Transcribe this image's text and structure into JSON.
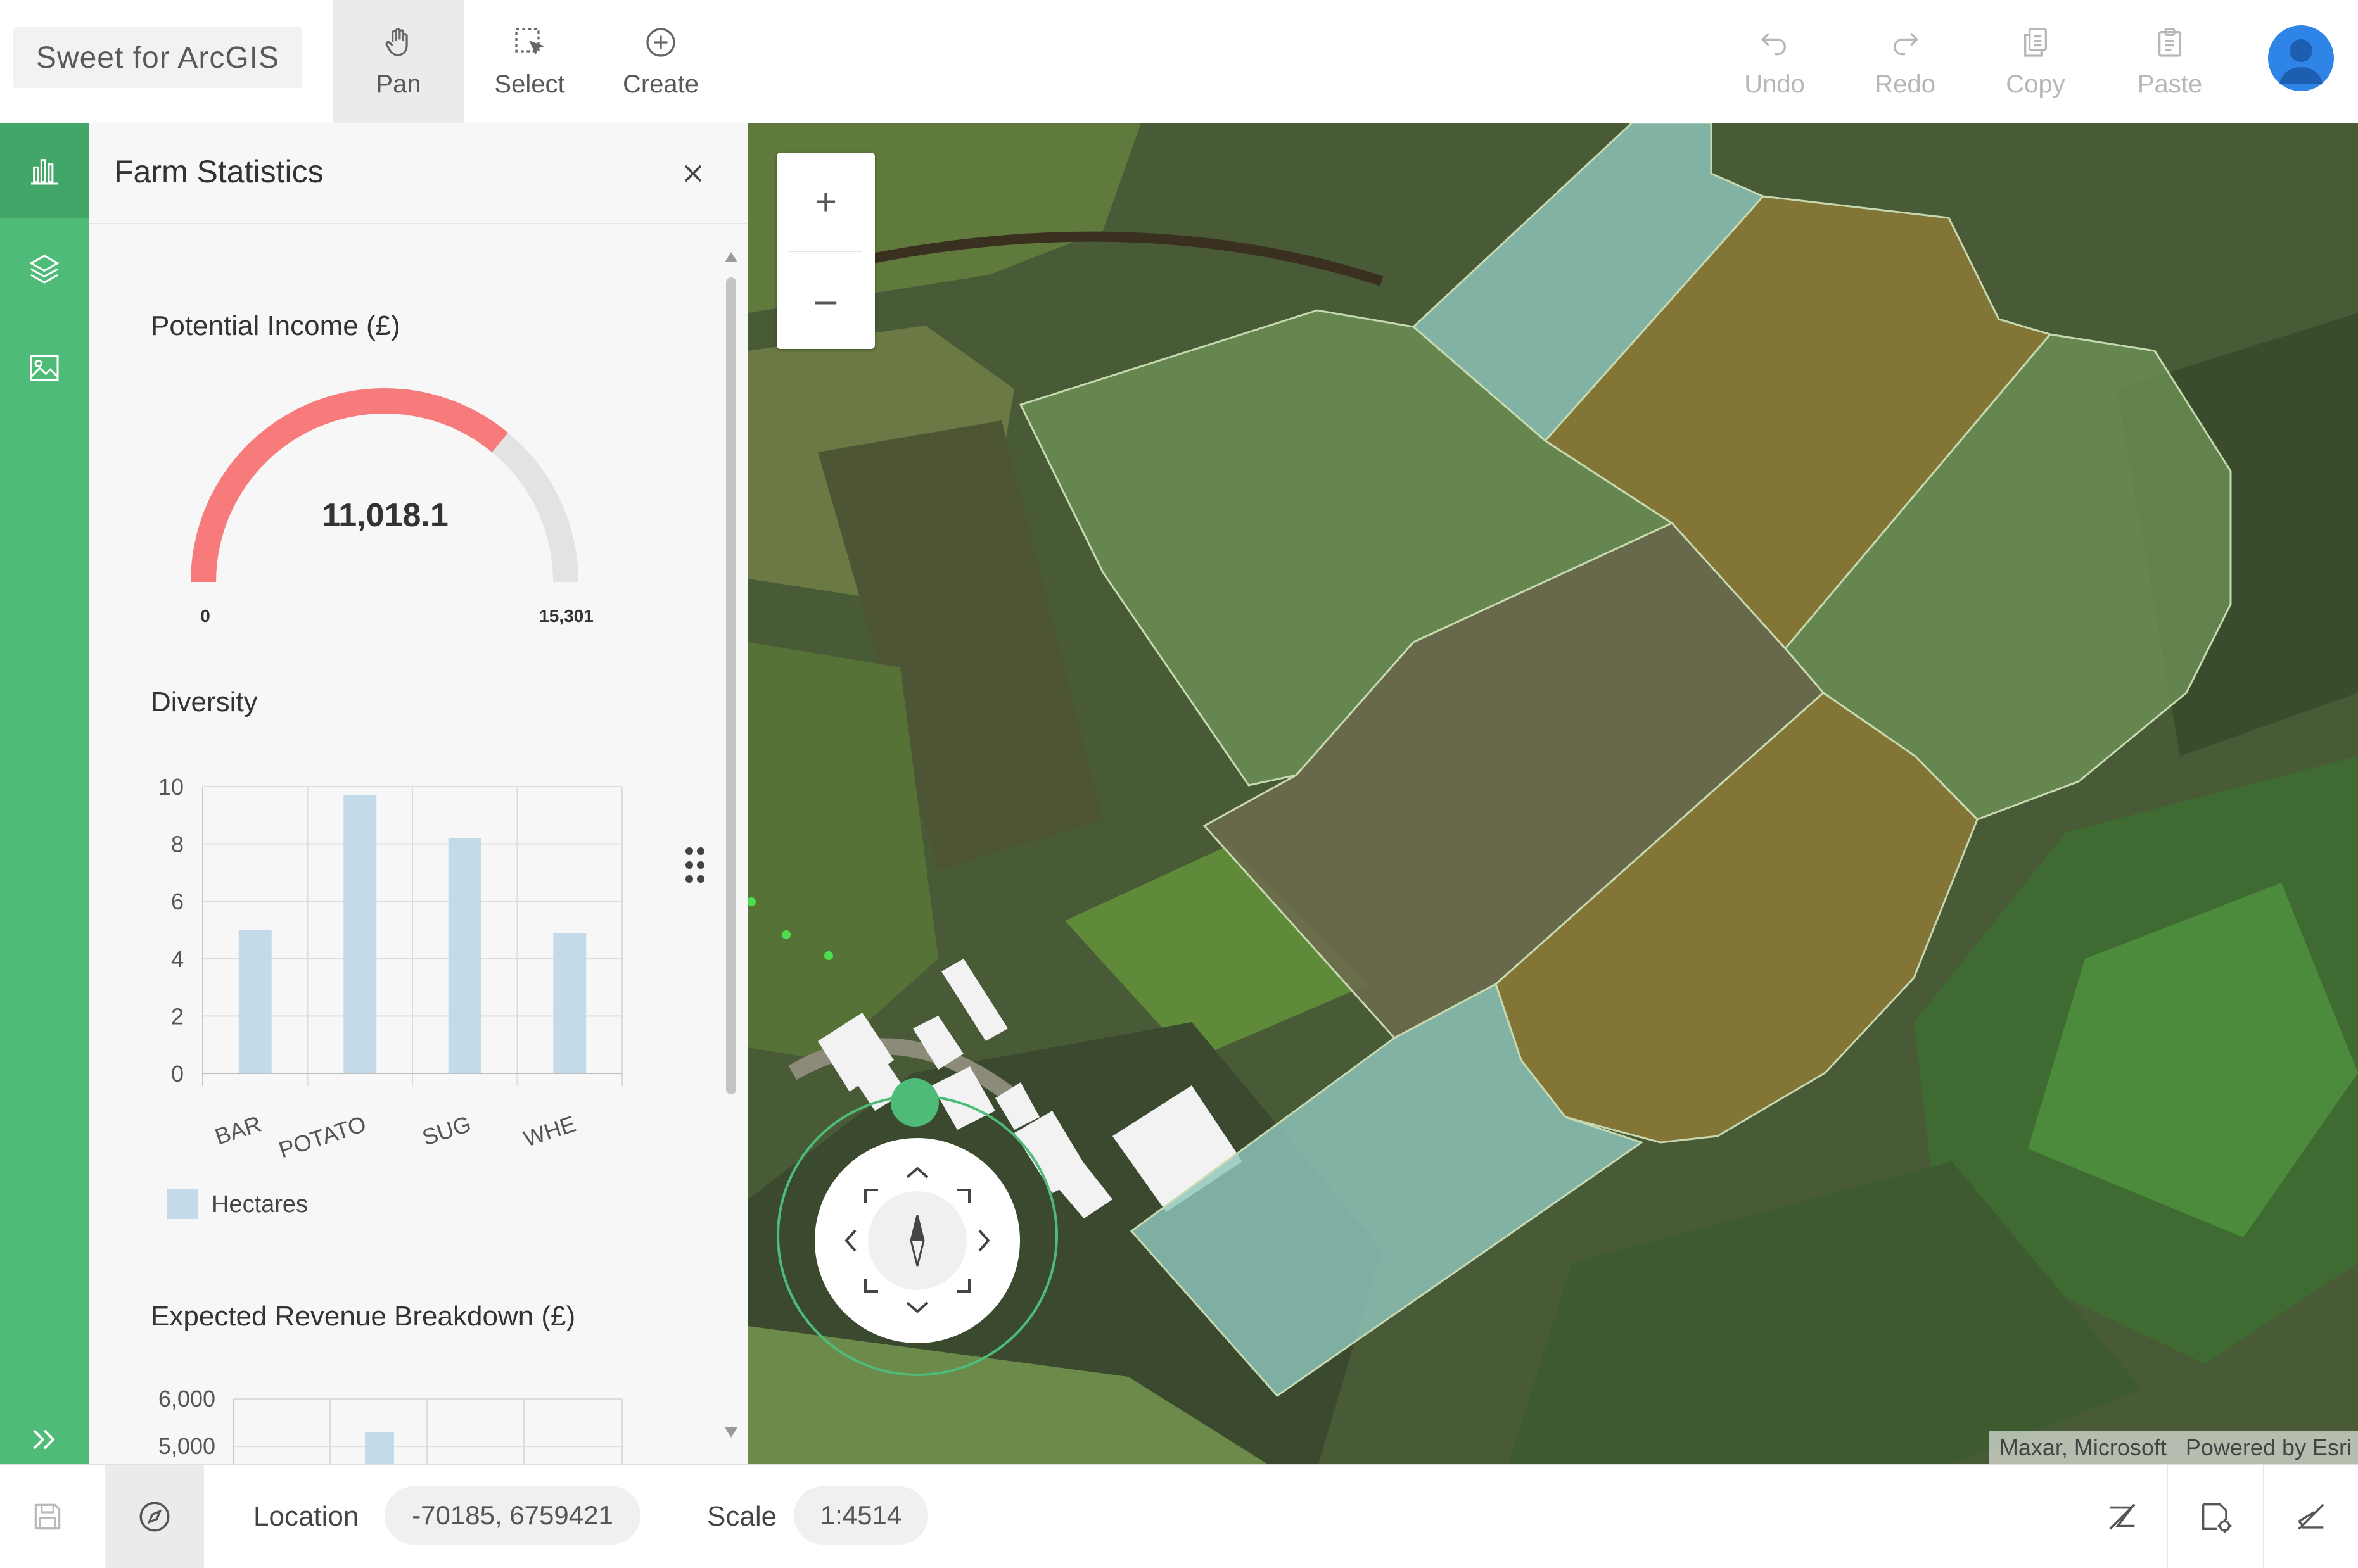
{
  "app": {
    "name": "Sweet for ArcGIS"
  },
  "toolbar": {
    "pan": "Pan",
    "select": "Select",
    "create": "Create",
    "undo": "Undo",
    "redo": "Redo",
    "copy": "Copy",
    "paste": "Paste"
  },
  "panel": {
    "title": "Farm Statistics",
    "gauge": {
      "title": "Potential Income (£)",
      "value_label": "11,018.1",
      "value": 11018.1,
      "min": 0,
      "max": 15301,
      "min_label": "0",
      "max_label": "15,301",
      "fill_color": "#f77b7b",
      "track_color": "#e3e3e3"
    },
    "diversity_title": "Diversity",
    "revenue_title": "Expected Revenue Breakdown (£)",
    "revenue_ticks": [
      "6,000",
      "5,000"
    ]
  },
  "chart_data": [
    {
      "type": "bar",
      "title": "Diversity",
      "categories": [
        "BAR",
        "POTATO",
        "SUG",
        "WHE"
      ],
      "series": [
        {
          "name": "Hectares",
          "values": [
            5,
            9.7,
            8.2,
            4.9
          ]
        }
      ],
      "ylim": [
        0,
        10
      ],
      "yticks": [
        "0",
        "2",
        "4",
        "6",
        "8",
        "10"
      ],
      "grid": true,
      "legend": "bottom-left",
      "color": "#c3dbe8"
    },
    {
      "type": "bar",
      "title": "Expected Revenue Breakdown (£)",
      "yticks": [
        "6,000",
        "5,000"
      ],
      "grid": true
    }
  ],
  "map": {
    "zoom_in": "+",
    "zoom_out": "–",
    "attribution_left": "Maxar, Microsoft",
    "attribution_right": "Powered by Esri"
  },
  "statusbar": {
    "location_label": "Location",
    "location_value": "-70185, 6759421",
    "scale_label": "Scale",
    "scale_value": "1:4514"
  },
  "colors": {
    "accent": "#4fbb78",
    "field_green": "#6a8e52",
    "field_olive": "#8c7a35",
    "field_teal": "#8fc6bc",
    "field_gray": "#6b6a4e"
  }
}
